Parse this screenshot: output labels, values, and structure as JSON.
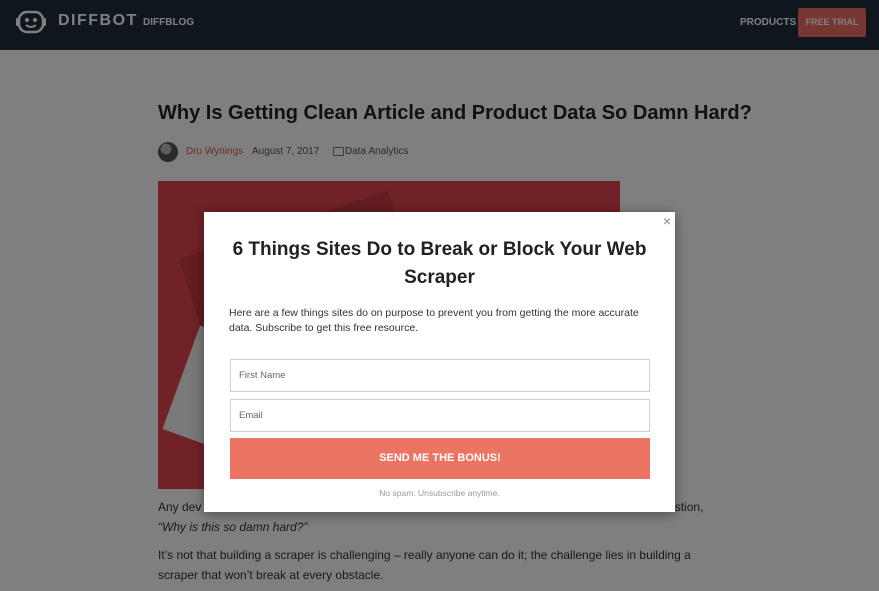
{
  "nav": {
    "brand": "DIFFBOT",
    "blog_link": "DIFFBLOG",
    "products_link": "PRODUCTS",
    "trial_button": "FREE TRIAL"
  },
  "article": {
    "title": "Why Is Getting Clean Article and Product Data So Damn Hard?",
    "author": "Dru Wynings",
    "date": "August 7, 2017",
    "category": "Data Analytics",
    "para1_start": "Any dev",
    "para1_end": "estion,",
    "para1_quote": "“Why is this so damn hard?”",
    "para2": "It’s not that building a scraper is challenging – really anyone can do it; the challenge lies in building a scraper that won’t break at every obstacle."
  },
  "modal": {
    "close": "×",
    "title": "6 Things Sites Do to Break or Block Your Web Scraper",
    "description": "Here are a few things sites do on purpose to prevent you from getting the more accurate data. Subscribe to get this free resource.",
    "first_name_placeholder": "First Name",
    "email_placeholder": "Email",
    "submit_label": "SEND ME THE BONUS!",
    "footnote": "No spam. Unsubscribe anytime."
  },
  "colors": {
    "nav_bg": "#1e2c3b",
    "accent": "#f06d63",
    "submit": "#ec7463",
    "hero": "#e0454d"
  }
}
